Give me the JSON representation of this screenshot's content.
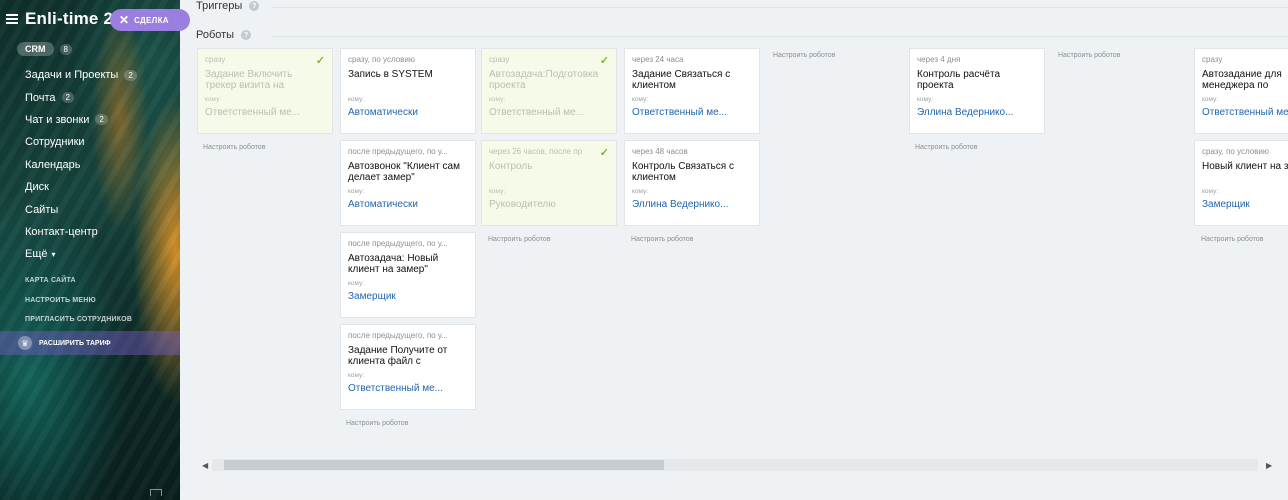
{
  "sidebar": {
    "logo": "Enli-time 2",
    "deal_button": "СДЕЛКА",
    "crm": {
      "label": "CRM",
      "count": "8"
    },
    "items": [
      {
        "label": "Задачи и Проекты",
        "count": "2"
      },
      {
        "label": "Почта",
        "count": "2"
      },
      {
        "label": "Чат и звонки",
        "count": "2"
      },
      {
        "label": "Сотрудники"
      },
      {
        "label": "Календарь"
      },
      {
        "label": "Диск"
      },
      {
        "label": "Сайты"
      },
      {
        "label": "Контакт-центр"
      },
      {
        "label": "Ещё"
      }
    ],
    "links": [
      "КАРТА САЙТА",
      "НАСТРОИТЬ МЕНЮ",
      "ПРИГЛАСИТЬ СОТРУДНИКОВ"
    ],
    "upgrade": "РАСШИРИТЬ ТАРИФ"
  },
  "main": {
    "triggers_title": "Триггеры",
    "robots_title": "Роботы",
    "setup_label": "Настроить роботов",
    "cards": [
      {
        "when": "сразу",
        "title": "Задание Включить трекер визита на",
        "to": "кому:",
        "resp": "Ответственный ме...",
        "done": true
      },
      {
        "when": "сразу, по условию",
        "title": "Запись в SYSTEM",
        "to": "кому:",
        "resp": "Автоматически",
        "done": false
      },
      {
        "when": "после предыдущего, по у...",
        "title": "Автозвонок \"Клиент сам делает замер\"",
        "to": "кому:",
        "resp": "Автоматически",
        "done": false
      },
      {
        "when": "после предыдущего, по у...",
        "title": "Автозадача: Новый клиент на замер\"",
        "to": "кому:",
        "resp": "Замерщик",
        "done": false
      },
      {
        "when": "после предыдущего, по у...",
        "title": "Задание Получите от клиента файл с",
        "to": "кому:",
        "resp": "Ответственный ме...",
        "done": false
      },
      {
        "when": "сразу",
        "title": "Автозадача:Подготовка проекта",
        "to": "кому:",
        "resp": "Ответственный ме...",
        "done": true
      },
      {
        "when": "через 26 часов, после пр",
        "title": "Контроль",
        "to": "кому:",
        "resp": "Руководителю",
        "done": true
      },
      {
        "when": "через 24 часа",
        "title": "Задание Связаться с клиентом",
        "to": "кому:",
        "resp": "Ответственный ме...",
        "done": false
      },
      {
        "when": "через 48 часов",
        "title": "Контроль Связаться с клиентом",
        "to": "кому:",
        "resp": "Эллина Ведернико...",
        "done": false
      },
      {
        "when": "через 4 дня",
        "title": "Контроль расчёта проекта",
        "to": "кому:",
        "resp": "Эллина Ведернико...",
        "done": false
      },
      {
        "when": "сразу",
        "title": "Автозадание для менеджера по",
        "to": "кому:",
        "resp": "Ответственный ме...",
        "done": false
      },
      {
        "when": "сразу, по условию",
        "title": "Новый клиент на замер",
        "to": "кому:",
        "resp": "Замерщик",
        "done": false
      }
    ]
  }
}
